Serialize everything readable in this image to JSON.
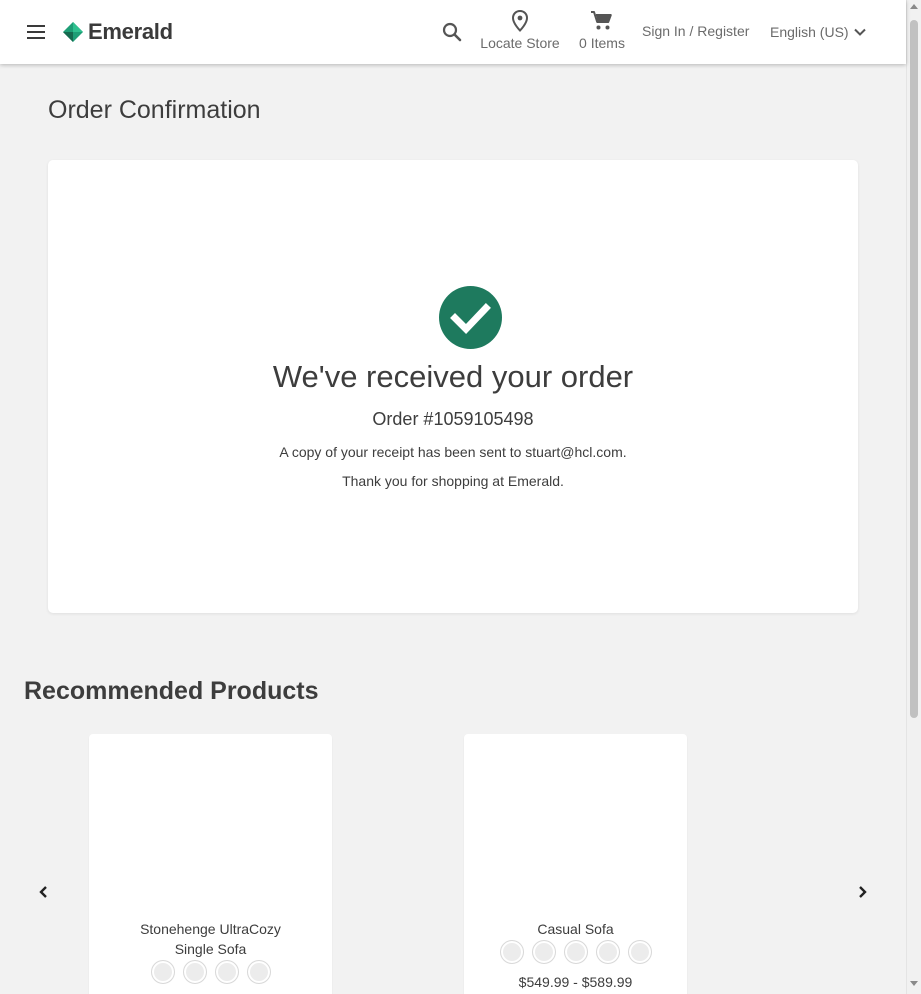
{
  "header": {
    "brand": "Emerald",
    "locate_store": "Locate Store",
    "cart_label": "0 Items",
    "sign_in": "Sign In / Register",
    "language": "English (US)"
  },
  "page": {
    "title": "Order Confirmation"
  },
  "confirmation": {
    "heading": "We've received your order",
    "order_number": "Order #1059105498",
    "receipt_message": "A copy of your receipt has been sent to stuart@hcl.com.",
    "thanks_message": "Thank you for shopping at Emerald."
  },
  "recommended": {
    "title": "Recommended Products",
    "products": [
      {
        "name": "Stonehenge UltraCozy Single Sofa",
        "swatch_count": 4,
        "price": ""
      },
      {
        "name": "Casual Sofa",
        "swatch_count": 5,
        "price": "$549.99 - $589.99"
      }
    ]
  },
  "colors": {
    "brand_green": "#1e7a5e",
    "background": "#f2f2f2",
    "text": "#3d3d3d"
  },
  "icons": [
    "menu-icon",
    "emerald-logo-icon",
    "search-icon",
    "location-pin-icon",
    "cart-icon",
    "chevron-down-icon",
    "check-circle-icon",
    "chevron-left-icon",
    "chevron-right-icon"
  ]
}
